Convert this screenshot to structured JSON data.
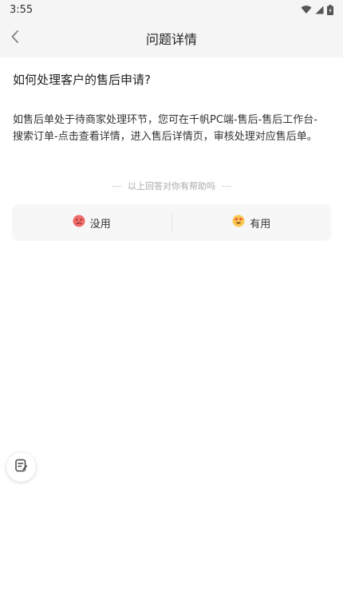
{
  "status_bar": {
    "time": "3:55",
    "icons": [
      "wifi-icon",
      "signal-icon",
      "battery-charging-icon"
    ]
  },
  "header": {
    "title": "问题详情",
    "back_icon": "chevron-left-icon"
  },
  "question": {
    "text": "如何处理客户的售后申请?"
  },
  "answer": {
    "text": "如售后单处于待商家处理环节，您可在千帆PC端-售后-售后工作台-搜索订单-点击查看详情，进入售后详情页，审核处理对应售后单。"
  },
  "helpful_prompt": {
    "text": "以上回答对你有帮助吗"
  },
  "feedback": {
    "useless": {
      "label": "没用",
      "icon": "sad-face-icon"
    },
    "useful": {
      "label": "有用",
      "icon": "heart-eyes-face-icon"
    }
  },
  "floating_button": {
    "icon": "feedback-note-icon"
  },
  "colors": {
    "header_bg": "#f5f5f5",
    "feedback_bg": "#f7f7f7",
    "useless_face": "#f26b6b",
    "useful_face": "#f9c74f"
  }
}
